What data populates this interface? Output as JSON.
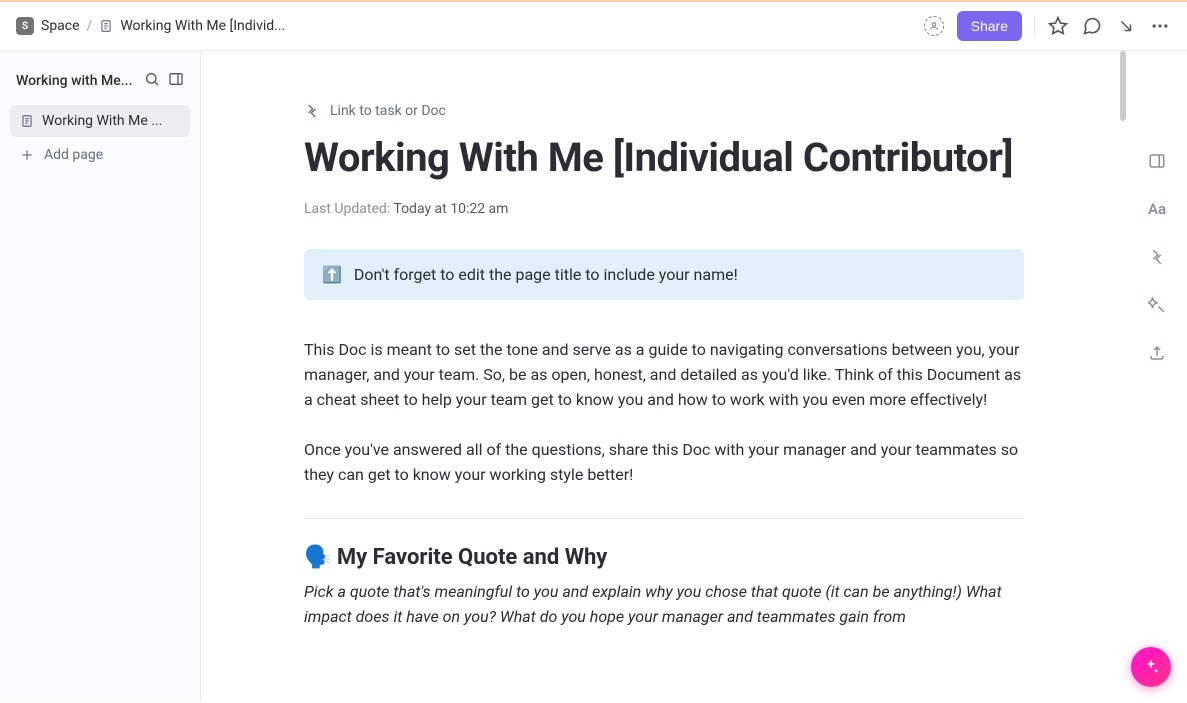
{
  "breadcrumb": {
    "space_icon_letter": "S",
    "space_label": "Space",
    "doc_label": "Working With Me [Individ..."
  },
  "topbar": {
    "share_label": "Share"
  },
  "sidebar": {
    "title": "Working with Me...",
    "page_item": "Working With Me ...",
    "add_page": "Add page"
  },
  "doc": {
    "link_task": "Link to task or Doc",
    "title": "Working With Me [Individual Contributor]",
    "last_updated_label": "Last Updated:",
    "last_updated_time": "Today at 10:22 am",
    "callout_emoji": "⬆️",
    "callout_text": "Don't forget to edit the page title to include your name!",
    "para1": "This Doc is meant to set the tone and serve as a guide to navigating conversations between you, your manager, and your team. So, be as open, honest, and detailed as you'd like. Think of this Document as a cheat sheet to help your team get to know you and how to work with you even more effectively!",
    "para2": "Once you've answered all of the questions, share this Doc with your manager and your teammates so they can get to know your working style better!",
    "section1_heading": "🗣️ My Favorite Quote and Why",
    "section1_sub": "Pick a quote that's meaningful to you and explain why you chose that quote (it can be anything!) What impact does it have on you? What do you hope your manager and teammates gain from"
  },
  "rail": {
    "aa": "Aa"
  }
}
